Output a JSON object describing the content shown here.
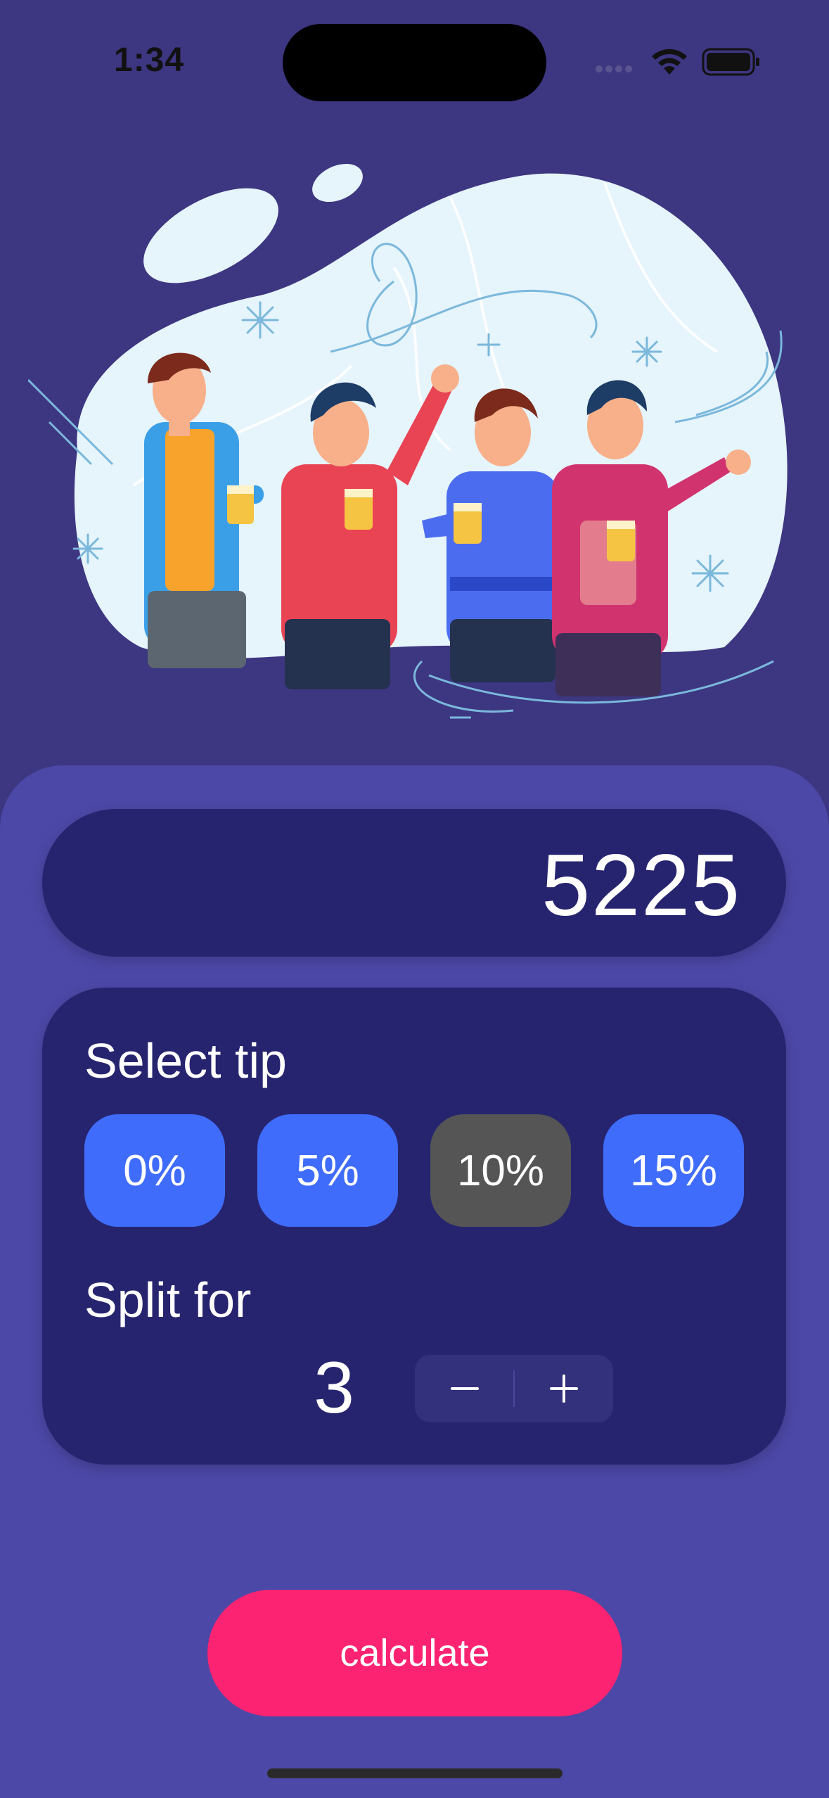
{
  "status_bar": {
    "time": "1:34"
  },
  "hero": {
    "illustration": "friends-toasting-beer-illustration",
    "colors": {
      "blob": "#e6f4fb",
      "line": "#7bb8dc"
    }
  },
  "bill": {
    "amount": "5225"
  },
  "tip": {
    "title": "Select tip",
    "options": [
      "0%",
      "5%",
      "10%",
      "15%"
    ],
    "selected": "10%"
  },
  "split": {
    "title": "Split for",
    "value": "3",
    "decrement_icon": "minus-icon",
    "increment_icon": "plus-icon"
  },
  "actions": {
    "calculate_label": "calculate"
  },
  "colors": {
    "background": "#3d3681",
    "panel": "#4c48a7",
    "card": "#27246f",
    "tip_button": "#3f6cfb",
    "tip_selected": "#555555",
    "calculate_button": "#fb2372"
  }
}
